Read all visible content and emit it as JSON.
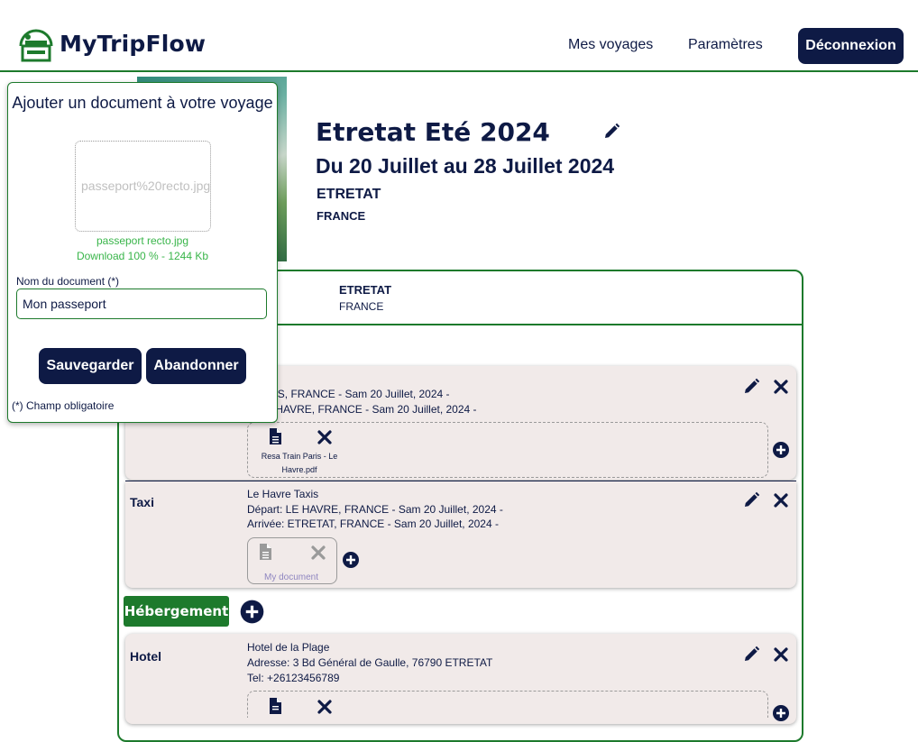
{
  "header": {
    "app_name": "MyTripFlow",
    "nav": [
      "Mes voyages",
      "Paramètres"
    ],
    "logout_label": "Déconnexion"
  },
  "trip": {
    "title": "Etretat Eté 2024",
    "dates": "Du 20 Juillet au 28 Juillet 2024",
    "city": "ETRETAT",
    "country": "FRANCE"
  },
  "destination": {
    "city": "ETRETAT",
    "country": "FRANCE"
  },
  "segments": [
    {
      "label": "",
      "line1": "",
      "line2": ": PARIS, FRANCE - Sam 20 Juillet, 2024 -",
      "line3": "e: LE HAVRE, FRANCE - Sam 20 Juillet, 2024 -",
      "document": "Resa Train Paris - Le Havre.pdf"
    },
    {
      "label": "Taxi",
      "line1": "Le Havre Taxis",
      "line2": "Départ: LE HAVRE, FRANCE - Sam 20 Juillet, 2024 -",
      "line3": "Arrivée: ETRETAT, FRANCE - Sam 20 Juillet, 2024 -",
      "document": "My document"
    }
  ],
  "accommodation_section": "Hébergement",
  "accommodation": {
    "label": "Hotel",
    "line1": "Hotel de la Plage",
    "line2": "Adresse: 3 Bd Général de Gaulle, 76790 ETRETAT",
    "line3": "Tel: +26123456789"
  },
  "popup": {
    "title": "Ajouter un document à votre voyage",
    "drop_file": "passeport%20recto.jpg",
    "upload_name": "passeport recto.jpg",
    "upload_status": "Download 100 % - 1244 Kb",
    "name_label": "Nom du document (*)",
    "name_value": "Mon passeport",
    "save_label": "Sauvegarder",
    "cancel_label": "Abandonner",
    "required_note": "(*) Champ obligatoire"
  },
  "colors": {
    "navy": "#0e1a45",
    "green": "#1d7a2c",
    "upload_green": "#39b54a",
    "segment_bg": "#f1eae9"
  },
  "icons": [
    "pencil-icon",
    "close-icon",
    "plus-circle-icon",
    "document-icon",
    "luggage-logo-icon"
  ]
}
